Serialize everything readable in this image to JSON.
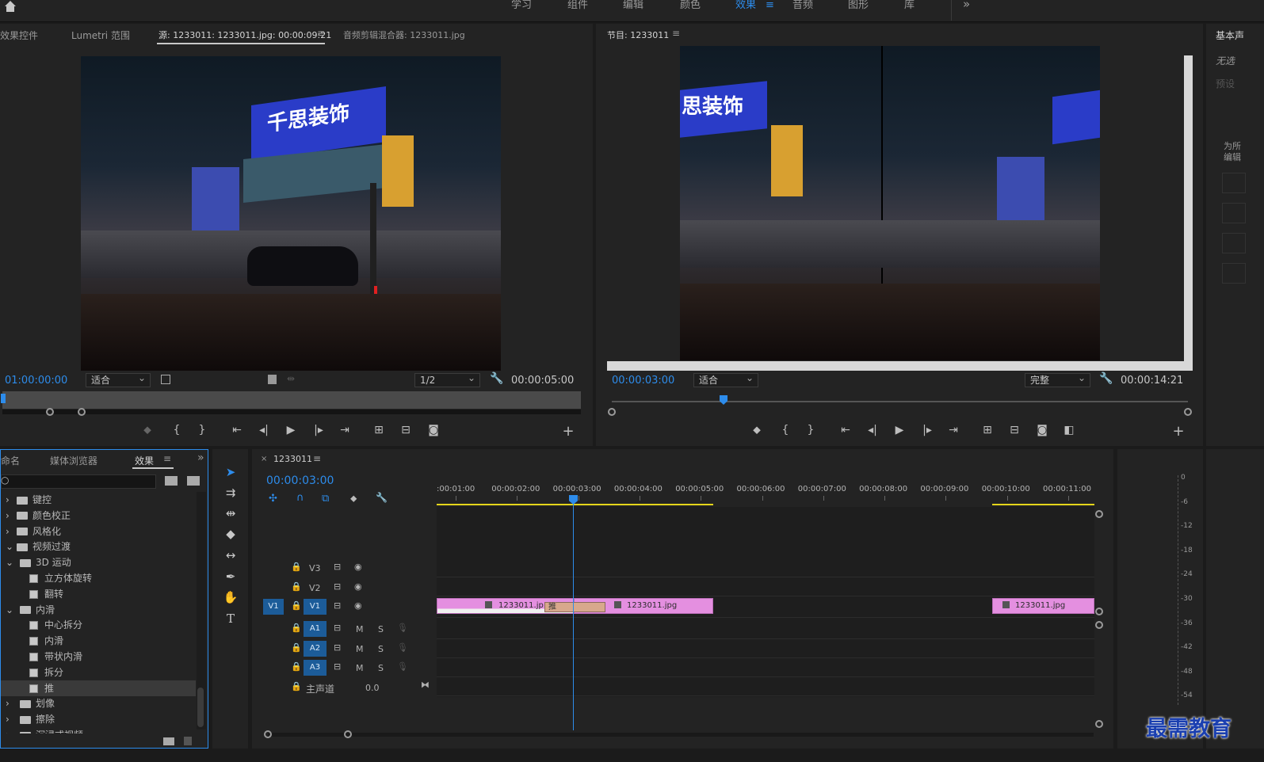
{
  "workspaces": [
    "学习",
    "组件",
    "编辑",
    "颜色",
    "效果",
    "音频",
    "图形",
    "库"
  ],
  "active_workspace": "效果",
  "more_glyph": "»",
  "source_tabs": [
    "效果控件",
    "Lumetri 范围",
    "源: 1233011: 1233011.jpg: 00:00:09:21",
    "音频剪辑混合器: 1233011.jpg"
  ],
  "source": {
    "timecode": "01:00:00:00",
    "fit": "适合",
    "resolution": "1/2",
    "duration": "00:00:05:00"
  },
  "program": {
    "title": "节目: 1233011",
    "timecode": "00:00:03:00",
    "fit": "适合",
    "quality": "完整",
    "duration": "00:00:14:21"
  },
  "right_panel": {
    "title": "基本声",
    "line1": "无选",
    "line2": "预设",
    "line3": "为所",
    "line4": "编辑"
  },
  "effects_tabs": [
    "命名",
    "媒体浏览器",
    "效果"
  ],
  "effects_tree": [
    {
      "label": "键控",
      "type": "folder",
      "level": 0
    },
    {
      "label": "颜色校正",
      "type": "folder",
      "level": 0
    },
    {
      "label": "风格化",
      "type": "folder",
      "level": 0
    },
    {
      "label": "视频过渡",
      "type": "folder",
      "level": 0,
      "open": true
    },
    {
      "label": "3D 运动",
      "type": "folder",
      "level": 1,
      "open": true
    },
    {
      "label": "立方体旋转",
      "type": "fx",
      "level": 2
    },
    {
      "label": "翻转",
      "type": "fx",
      "level": 2
    },
    {
      "label": "内滑",
      "type": "folder",
      "level": 1,
      "open": true
    },
    {
      "label": "中心拆分",
      "type": "fx",
      "level": 2
    },
    {
      "label": "内滑",
      "type": "fx",
      "level": 2
    },
    {
      "label": "带状内滑",
      "type": "fx",
      "level": 2
    },
    {
      "label": "拆分",
      "type": "fx",
      "level": 2
    },
    {
      "label": "推",
      "type": "fx",
      "level": 2,
      "selected": true
    },
    {
      "label": "划像",
      "type": "folder",
      "level": 1
    },
    {
      "label": "擦除",
      "type": "folder",
      "level": 1
    },
    {
      "label": "沉浸式视频",
      "type": "folder",
      "level": 1
    }
  ],
  "timeline": {
    "tab": "1233011",
    "timecode": "00:00:03:00",
    "ruler": [
      ":00:01:00",
      "00:00:02:00",
      "00:00:03:00",
      "00:00:04:00",
      "00:00:05:00",
      "00:00:06:00",
      "00:00:07:00",
      "00:00:08:00",
      "00:00:09:00",
      "00:00:10:00",
      "00:00:11:00"
    ],
    "video_tracks": [
      "V3",
      "V2",
      "V1"
    ],
    "audio_tracks": [
      "A1",
      "A2",
      "A3"
    ],
    "source_patch": "V1",
    "mute": "M",
    "solo": "S",
    "master": "主声道",
    "master_value": "0.0",
    "clips": [
      {
        "name": "1233011.jp"
      },
      {
        "name": "1233011.jpg"
      },
      {
        "name": "1233011.jpg"
      }
    ],
    "transition": "推"
  },
  "meter_labels": [
    "0",
    "-6",
    "-12",
    "-18",
    "-24",
    "-30",
    "-36",
    "-42",
    "-48",
    "-54"
  ],
  "watermark": "最需教育"
}
